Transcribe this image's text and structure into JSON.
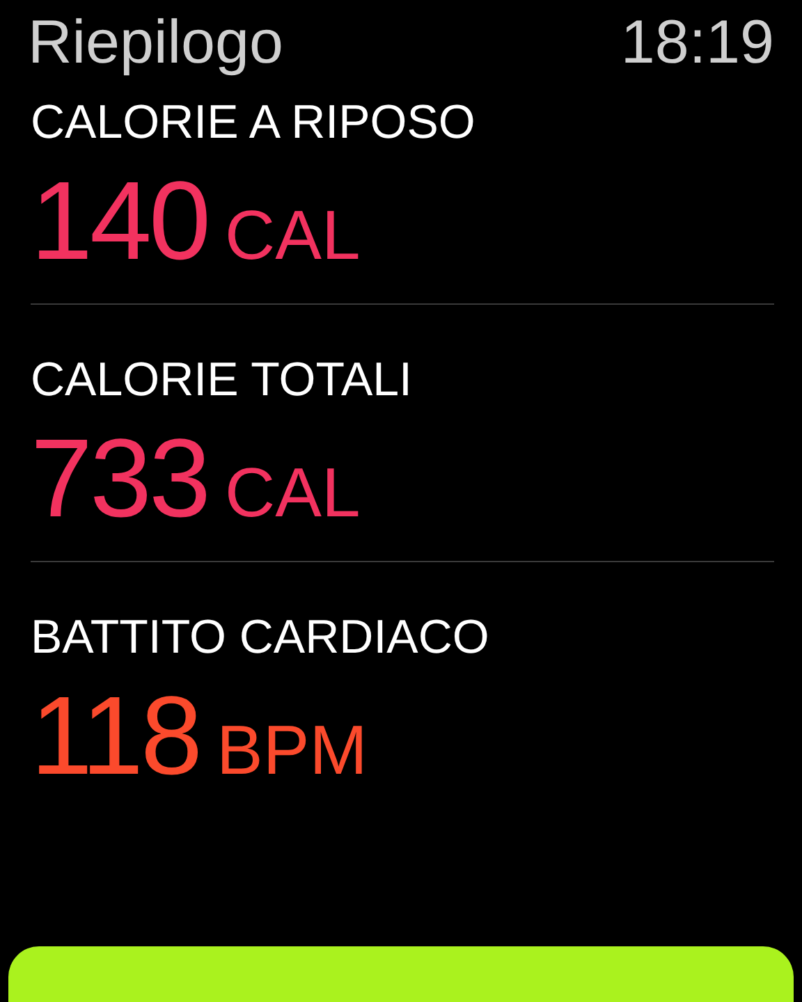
{
  "header": {
    "title": "Riepilogo",
    "time": "18:19"
  },
  "metrics": [
    {
      "label": "CALORIE A RIPOSO",
      "value": "140",
      "unit": "CAL",
      "color": "#f2325f"
    },
    {
      "label": "CALORIE TOTALI",
      "value": "733",
      "unit": "CAL",
      "color": "#f2325f"
    },
    {
      "label": "BATTITO CARDIACO",
      "value": "118",
      "unit": "BPM",
      "color": "#fb4a2c"
    }
  ]
}
